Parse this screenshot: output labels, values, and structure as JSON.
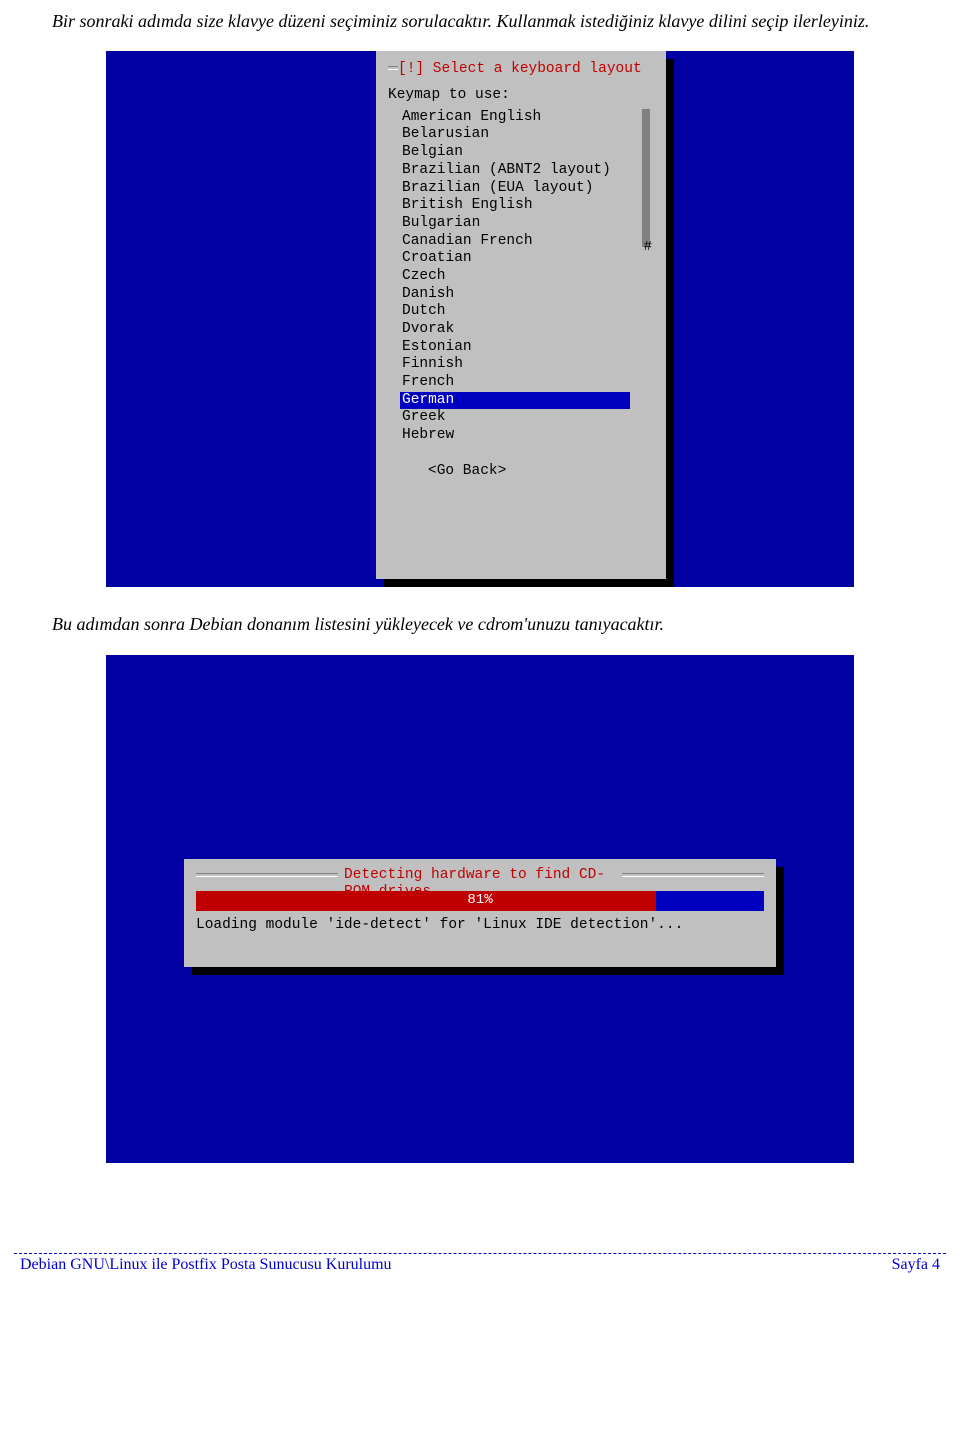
{
  "intro_text": "Bir sonraki adımda size klavye düzeni seçiminiz sorulacaktır. Kullanmak istediğiniz klavye dilini seçip ilerleyiniz.",
  "dialog1": {
    "title": "[!] Select a keyboard layout",
    "label": "Keymap to use:",
    "items": [
      "American English",
      "Belarusian",
      "Belgian",
      "Brazilian (ABNT2 layout)",
      "Brazilian (EUA layout)",
      "British English",
      "Bulgarian",
      "Canadian French",
      "Croatian",
      "Czech",
      "Danish",
      "Dutch",
      "Dvorak",
      "Estonian",
      "Finnish",
      "French",
      "German",
      "Greek",
      "Hebrew"
    ],
    "selected_index": 16,
    "scroll_hash": "#",
    "go_back": "<Go Back>"
  },
  "mid_text": "Bu adımdan sonra Debian donanım listesini yükleyecek ve cdrom'unuzu tanıyacaktır.",
  "dialog2": {
    "title": "Detecting hardware to find CD-ROM drives",
    "percent_label": "81%",
    "percent_value": 81,
    "status": "Loading module 'ide-detect' for 'Linux IDE detection'..."
  },
  "footer": {
    "left": "Debian GNU\\Linux ile Postfix Posta Sunucusu Kurulumu",
    "right": "Sayfa 4"
  }
}
